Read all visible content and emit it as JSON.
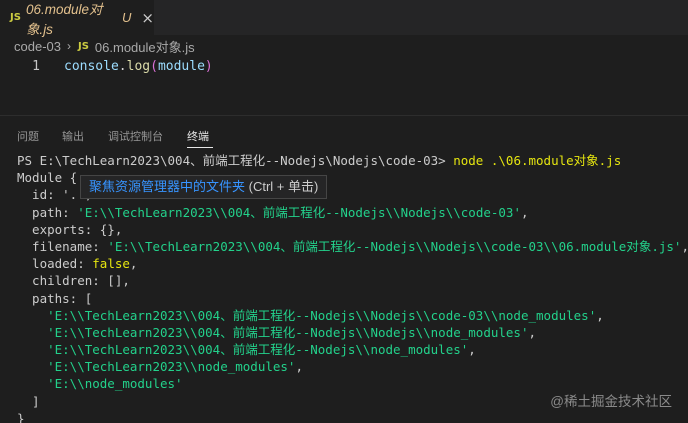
{
  "tab": {
    "lang_badge": "JS",
    "title": "06.module对象.js",
    "modified_marker": "U",
    "close_glyph": "×"
  },
  "breadcrumb": {
    "folder": "code-03",
    "separator": "›",
    "lang_badge": "JS",
    "file": "06.module对象.js"
  },
  "editor": {
    "line_number": "1",
    "object": "console",
    "dot": ".",
    "method": "log",
    "open_paren": "(",
    "arg": "module",
    "close_paren": ")"
  },
  "panel": {
    "tabs": [
      {
        "label": "问题"
      },
      {
        "label": "输出"
      },
      {
        "label": "调试控制台"
      },
      {
        "label": "终端"
      }
    ]
  },
  "terminal": {
    "prompt": "PS E:\\TechLearn2023\\004、前端工程化--Nodejs\\Nodejs\\code-03> ",
    "command": "node .\\06.module对象.js",
    "lines": [
      "Module {",
      "  id: '.',",
      "  path: ",
      "'E:\\\\TechLearn2023\\\\004、前端工程化--Nodejs\\\\Nodejs\\\\code-03'",
      "  exports: {},",
      "  filename: ",
      "'E:\\\\TechLearn2023\\\\004、前端工程化--Nodejs\\\\Nodejs\\\\code-03\\\\06.module对象.js'",
      "  loaded: ",
      "false",
      "  children: [],",
      "  paths: [",
      "    'E:\\\\TechLearn2023\\\\004、前端工程化--Nodejs\\\\Nodejs\\\\code-03\\\\node_modules'",
      "    'E:\\\\TechLearn2023\\\\004、前端工程化--Nodejs\\\\Nodejs\\\\node_modules'",
      "    'E:\\\\TechLearn2023\\\\004、前端工程化--Nodejs\\\\node_modules'",
      "    'E:\\\\TechLearn2023\\\\node_modules'",
      "    'E:\\\\node_modules'",
      "  ]",
      "}"
    ],
    "comma": ","
  },
  "tooltip": {
    "link_text": "聚焦资源管理器中的文件夹",
    "hint": " (Ctrl + 单击)"
  },
  "watermark": "@稀土掘金技术社区"
}
